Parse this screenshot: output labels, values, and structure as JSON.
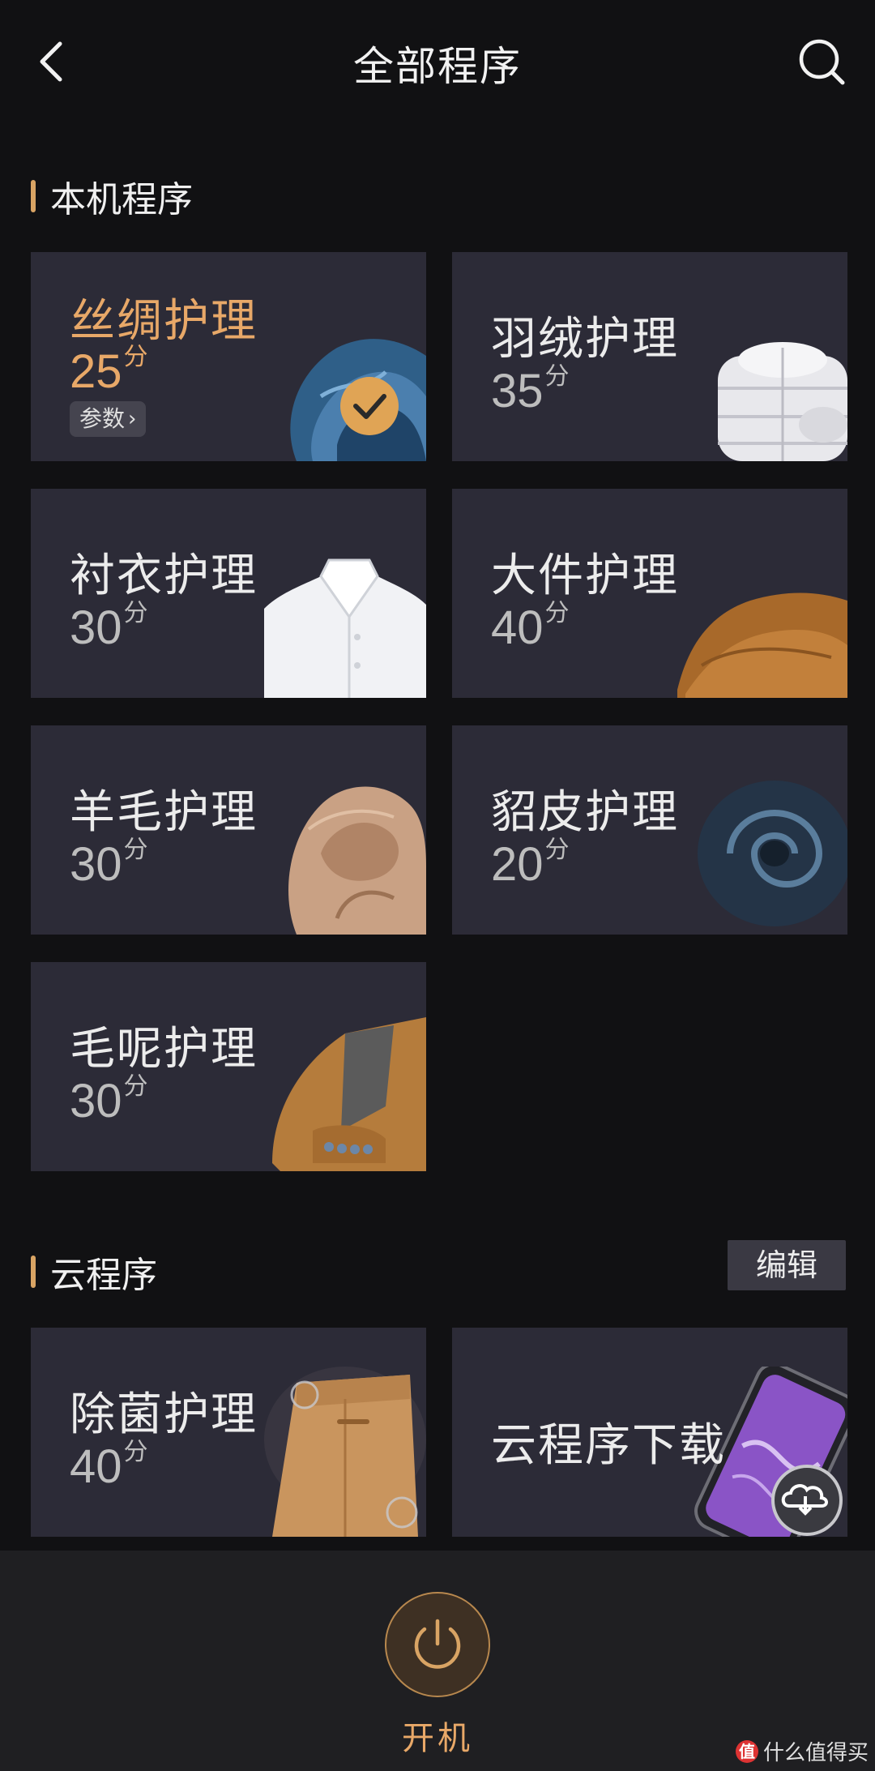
{
  "header": {
    "title": "全部程序"
  },
  "sections": {
    "local": {
      "title": "本机程序"
    },
    "cloud": {
      "title": "云程序",
      "edit_label": "编辑"
    }
  },
  "programs": [
    {
      "name": "丝绸护理",
      "time": "25",
      "unit": "分",
      "params_label": "参数",
      "selected": true
    },
    {
      "name": "羽绒护理",
      "time": "35",
      "unit": "分"
    },
    {
      "name": "衬衣护理",
      "time": "30",
      "unit": "分"
    },
    {
      "name": "大件护理",
      "time": "40",
      "unit": "分"
    },
    {
      "name": "羊毛护理",
      "time": "30",
      "unit": "分"
    },
    {
      "name": "貂皮护理",
      "time": "20",
      "unit": "分"
    },
    {
      "name": "毛呢护理",
      "time": "30",
      "unit": "分"
    }
  ],
  "cloud_programs": [
    {
      "name": "除菌护理",
      "time": "40",
      "unit": "分"
    },
    {
      "name": "云程序下载"
    }
  ],
  "footer": {
    "power_label": "开机"
  },
  "watermark": {
    "logo": "值",
    "text": "什么值得买"
  },
  "colors": {
    "accent": "#e8a868",
    "card_bg": "#2c2b37",
    "page_bg": "#111113"
  }
}
